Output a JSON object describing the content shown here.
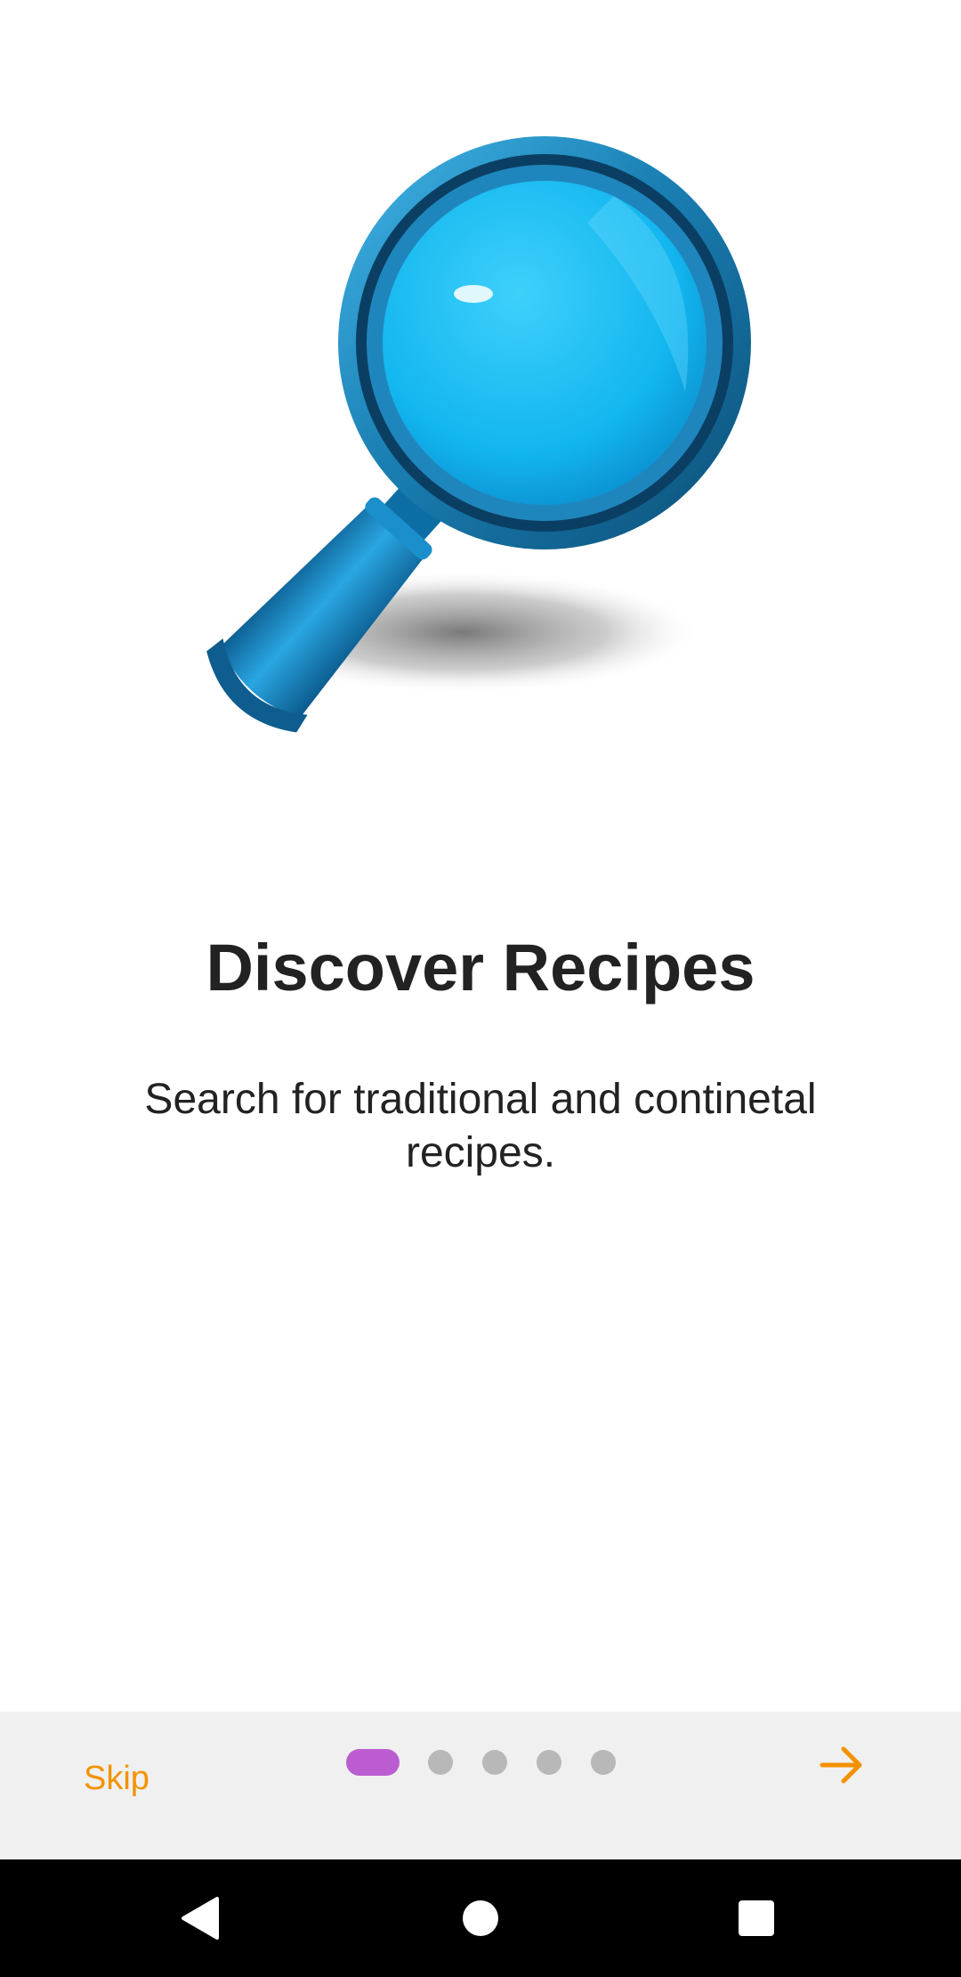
{
  "hero": {
    "image_name": "magnifying-glass",
    "glass_color": "#1ba3e0",
    "lens_color": "#2ec6f5"
  },
  "content": {
    "title": "Discover Recipes",
    "description": "Search for traditional and continetal recipes."
  },
  "onboarding": {
    "skip_label": "Skip",
    "page_count": 5,
    "current_page": 1,
    "next_icon": "arrow-right-icon",
    "accent_color": "#f39200",
    "active_dot_color": "#bb5dd0",
    "inactive_dot_color": "#b8b8b8"
  },
  "system_nav": {
    "back_icon": "back-triangle-icon",
    "home_icon": "home-circle-icon",
    "recents_icon": "recents-square-icon"
  }
}
